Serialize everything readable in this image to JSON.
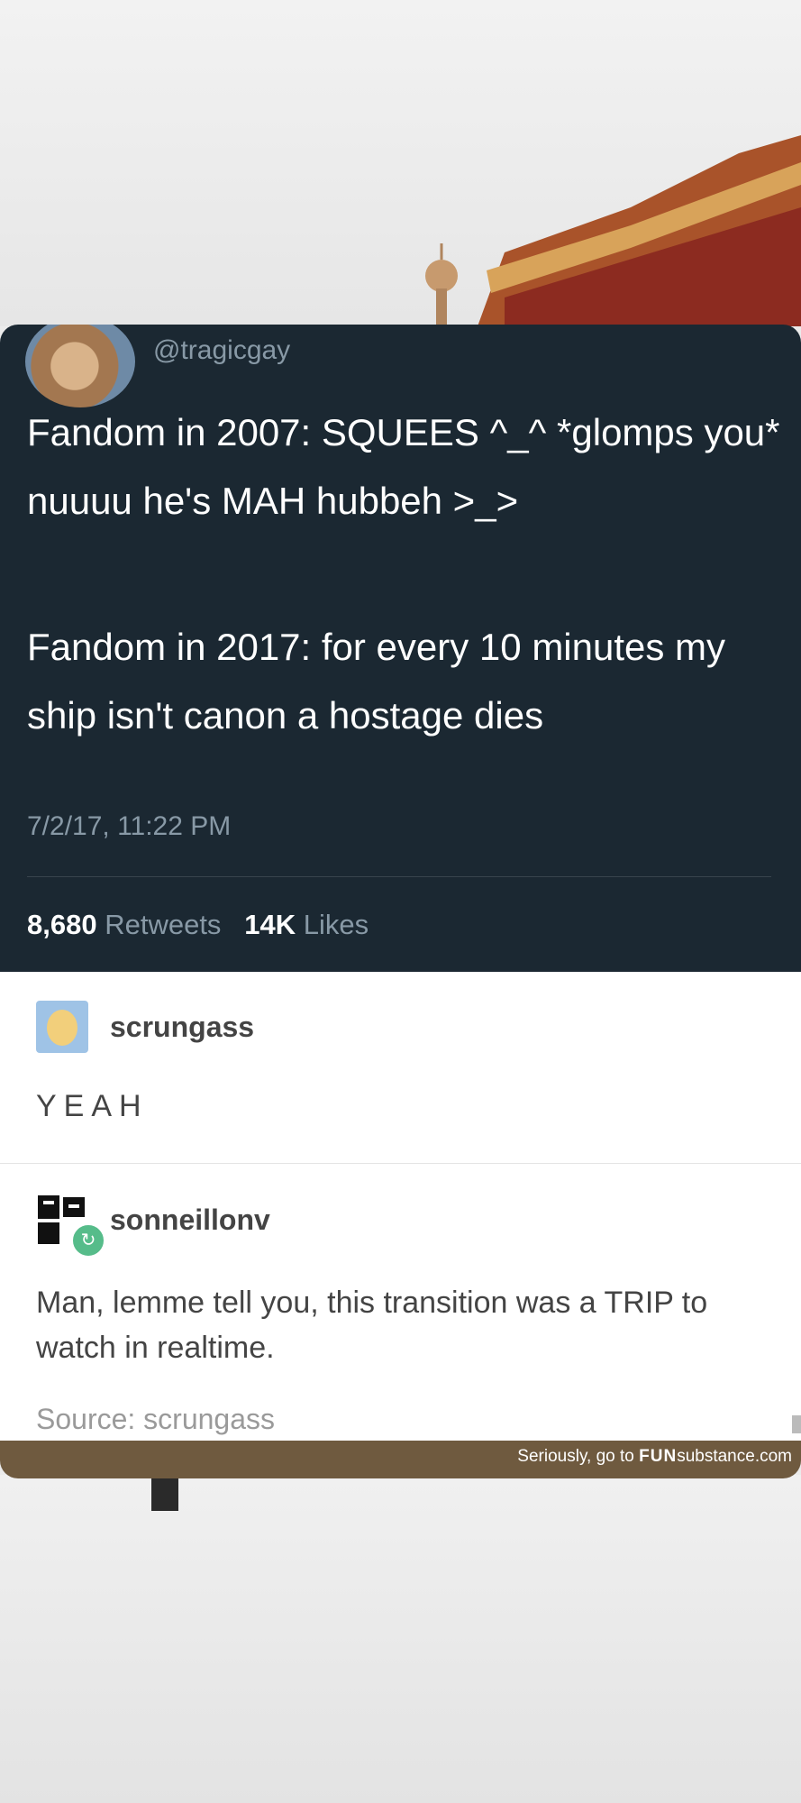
{
  "tweet": {
    "handle": "@tragicgay",
    "line1": "Fandom in 2007: SQUEES ^_^ *glomps you* nuuuu he's MAH hubbeh >_>",
    "line2": "Fandom in 2017: for every 10 minutes my ship isn't canon a hostage dies",
    "timestamp": "7/2/17, 11:22 PM",
    "retweets_count": "8,680",
    "retweets_label": "Retweets",
    "likes_count": "14K",
    "likes_label": "Likes"
  },
  "post1": {
    "username": "scrungass",
    "text": "YEAH"
  },
  "post2": {
    "username": "sonneillonv",
    "text": "Man, lemme tell you, this transition was a TRIP to watch in realtime.",
    "source": "Source: scrungass"
  },
  "footer": {
    "prefix": "Seriously, go to ",
    "brand_bold": "FUN",
    "brand_rest": "substance",
    "tld": ".com"
  },
  "colors": {
    "tweet_bg": "#1b2832",
    "footer_bar": "#6f5a3f",
    "reblog_badge": "#56bc8a"
  }
}
